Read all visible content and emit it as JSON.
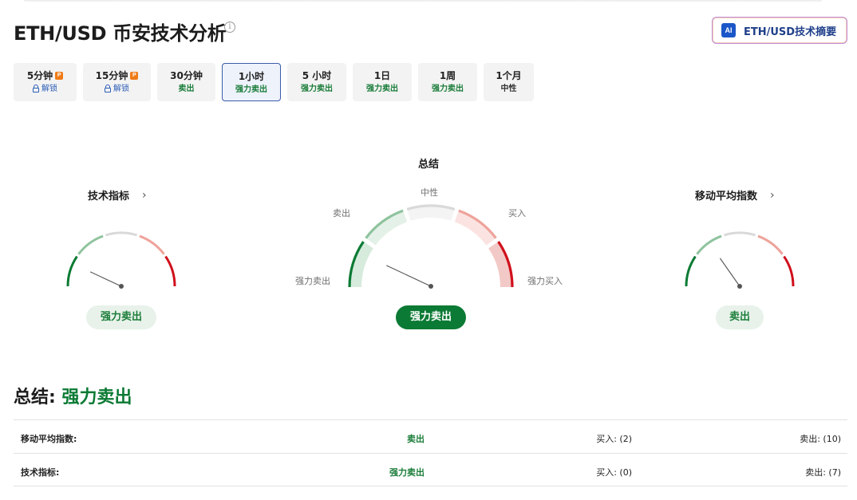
{
  "page": {
    "title": "ETH/USD 币安技术分析",
    "ai_button_label": "ETH/USD技术摘要",
    "ai_badge": "AI"
  },
  "tabs": [
    {
      "label": "5分钟",
      "status": "解锁",
      "locked": true
    },
    {
      "label": "15分钟",
      "status": "解锁",
      "locked": true
    },
    {
      "label": "30分钟",
      "status": "卖出"
    },
    {
      "label": "1小时",
      "status": "强力卖出",
      "active": true
    },
    {
      "label": "5 小时",
      "status": "强力卖出"
    },
    {
      "label": "1日",
      "status": "强力卖出"
    },
    {
      "label": "1周",
      "status": "强力卖出"
    },
    {
      "label": "1个月",
      "status": "中性"
    }
  ],
  "gauges": {
    "technical": {
      "title": "技术指标",
      "result": "强力卖出",
      "needle_angle": -65
    },
    "summary": {
      "title": "总结",
      "result": "强力卖出",
      "needle_angle": -64,
      "labels": {
        "strong_sell": "强力卖出",
        "sell": "卖出",
        "neutral": "中性",
        "buy": "买入",
        "strong_buy": "强力买入"
      }
    },
    "moving_avg": {
      "title": "移动平均指数",
      "result": "卖出",
      "needle_angle": -35
    }
  },
  "summary": {
    "heading_label": "总结:",
    "heading_value": "强力卖出"
  },
  "table": [
    {
      "name": "移动平均指数:",
      "signal": "卖出",
      "buy": "买入: (2)",
      "sell": "卖出: (10)"
    },
    {
      "name": "技术指标:",
      "signal": "强力卖出",
      "buy": "买入: (0)",
      "sell": "卖出: (7)"
    }
  ],
  "colors": {
    "strong_sell": "#0b7a34",
    "sell": "#8fc39e",
    "neutral": "#d9d9d9",
    "buy": "#eea39b",
    "strong_buy": "#d0101c"
  }
}
